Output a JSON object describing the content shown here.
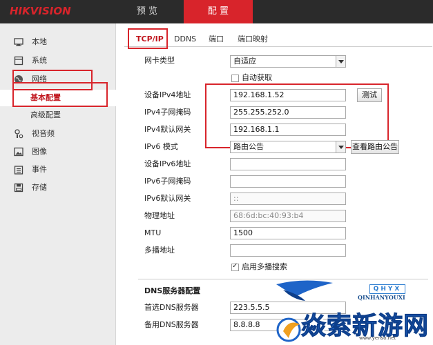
{
  "brand": {
    "logo_text": "HIKVISION",
    "accent": "#d8242b"
  },
  "topnav": {
    "preview": "预 览",
    "config": "配 置"
  },
  "sidebar": {
    "items": [
      {
        "label": "本地",
        "icon": "monitor-icon"
      },
      {
        "label": "系统",
        "icon": "system-icon"
      },
      {
        "label": "网络",
        "icon": "globe-icon"
      },
      {
        "label": "视音频",
        "icon": "video-audio-icon"
      },
      {
        "label": "图像",
        "icon": "image-icon"
      },
      {
        "label": "事件",
        "icon": "event-icon"
      },
      {
        "label": "存储",
        "icon": "storage-icon"
      }
    ],
    "network_sub": {
      "basic": "基本配置",
      "advanced": "高级配置"
    }
  },
  "tabs": [
    "TCP/IP",
    "DDNS",
    "端口",
    "端口映射"
  ],
  "form": {
    "nic_type": {
      "label": "网卡类型",
      "value": "自适应"
    },
    "auto_obtain": {
      "label": "自动获取"
    },
    "ipv4_address": {
      "label": "设备IPv4地址",
      "value": "192.168.1.52"
    },
    "test_button": "测试",
    "ipv4_mask": {
      "label": "IPv4子网掩码",
      "value": "255.255.252.0"
    },
    "ipv4_gateway": {
      "label": "IPv4默认网关",
      "value": "192.168.1.1"
    },
    "ipv6_mode": {
      "label": "IPv6 模式",
      "value": "路由公告"
    },
    "view_route_button": "查看路由公告",
    "ipv6_address": {
      "label": "设备IPv6地址",
      "value": ""
    },
    "ipv6_mask": {
      "label": "IPv6子网掩码",
      "value": ""
    },
    "ipv6_gateway": {
      "label": "IPv6默认网关",
      "value": "::"
    },
    "mac": {
      "label": "物理地址",
      "value": "68:6d:bc:40:93:b4"
    },
    "mtu": {
      "label": "MTU",
      "value": "1500"
    },
    "multicast": {
      "label": "多播地址",
      "value": ""
    },
    "multicast_search": {
      "label": "启用多播搜索"
    },
    "dns_section": "DNS服务器配置",
    "dns_primary": {
      "label": "首选DNS服务器",
      "value": "223.5.5.5"
    },
    "dns_secondary": {
      "label": "备用DNS服务器",
      "value": "8.8.8.8"
    }
  },
  "watermark": {
    "brand_box": "QHYX",
    "brand_sub": "QINHANYOUXI",
    "logo_text": "焱索新游网",
    "url": "www.yenso.net"
  }
}
